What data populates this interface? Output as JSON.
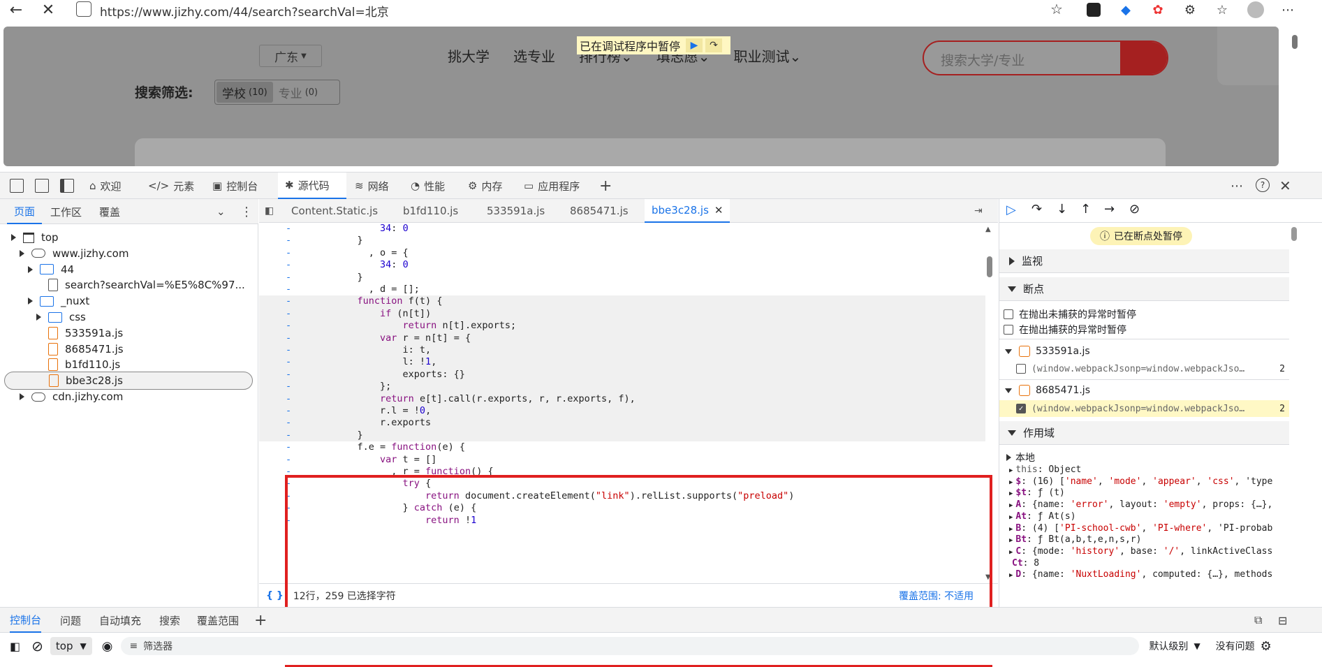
{
  "browser": {
    "url": "https://www.jizhy.com/44/search?searchVal=北京"
  },
  "page": {
    "province": "广东",
    "nav": [
      "挑大学",
      "选专业",
      "排行榜",
      "填志愿",
      "职业测试"
    ],
    "search_placeholder": "搜索大学/专业",
    "filter_label": "搜索筛选:",
    "filter_school": "学校",
    "filter_school_count": "(10)",
    "filter_major": "专业",
    "filter_major_count": "(0)",
    "paused_banner": "已在调试程序中暂停"
  },
  "devtools": {
    "tabs": [
      "欢迎",
      "元素",
      "控制台",
      "源代码",
      "网络",
      "性能",
      "内存",
      "应用程序"
    ],
    "active_tab": "源代码",
    "nav_tabs": [
      "页面",
      "工作区",
      "覆盖"
    ],
    "tree": [
      {
        "label": "top",
        "kind": "window",
        "indent": 0,
        "open": true
      },
      {
        "label": "www.jizhy.com",
        "kind": "cloud",
        "indent": 1,
        "open": true
      },
      {
        "label": "44",
        "kind": "folder",
        "indent": 2,
        "open": true
      },
      {
        "label": "search?searchVal=%E5%8C%97...",
        "kind": "file",
        "indent": 3
      },
      {
        "label": "_nuxt",
        "kind": "folder",
        "indent": 2,
        "open": true
      },
      {
        "label": "css",
        "kind": "folder",
        "indent": 3,
        "open": false
      },
      {
        "label": "533591a.js",
        "kind": "js",
        "indent": 3
      },
      {
        "label": "8685471.js",
        "kind": "js",
        "indent": 3
      },
      {
        "label": "b1fd110.js",
        "kind": "js",
        "indent": 3
      },
      {
        "label": "bbe3c28.js",
        "kind": "js",
        "indent": 3,
        "selected": true
      },
      {
        "label": "cdn.jizhy.com",
        "kind": "cloud",
        "indent": 1,
        "open": false
      }
    ],
    "editor_tabs": [
      "Content.Static.js",
      "b1fd110.js",
      "533591a.js",
      "8685471.js",
      "bbe3c28.js"
    ],
    "active_editor_tab": "bbe3c28.js",
    "code": [
      "        34: 0",
      "    }",
      "      , o = {",
      "        34: 0",
      "    }",
      "      , d = [];",
      "    function f(t) {",
      "        if (n[t])",
      "            return n[t].exports;",
      "        var r = n[t] = {",
      "            i: t,",
      "            l: !1,",
      "            exports: {}",
      "        };",
      "        return e[t].call(r.exports, r, r.exports, f),",
      "        r.l = !0,",
      "        r.exports",
      "    }",
      "    f.e = function(e) {",
      "        var t = []",
      "          , r = function() {",
      "            try {",
      "                return document.createElement(\"link\").relList.supports(\"preload\")",
      "            } catch (e) {",
      "                return !1"
    ],
    "status_text": "12行，259 已选择字符",
    "coverage_text": "覆盖范围: 不适用",
    "paused_badge": "已在断点处暂停",
    "sections": {
      "watch": "监视",
      "breakpoints": "断点",
      "scope": "作用域"
    },
    "exception_opts": [
      "在抛出未捕获的异常时暂停",
      "在抛出捕获的异常时暂停"
    ],
    "bp_files": [
      {
        "file": "533591a.js",
        "snippet": "(window.webpackJsonp=window.webpackJso…",
        "line": "2",
        "checked": false
      },
      {
        "file": "8685471.js",
        "snippet": "(window.webpackJsonp=window.webpackJso…",
        "line": "2",
        "checked": true
      }
    ],
    "scope_local": "本地",
    "scope_lines": [
      {
        "k": "this",
        "v": ": Object",
        "plain": true
      },
      {
        "k": "$",
        "v": ": (16) ['name', 'mode', 'appear', 'css', 'type"
      },
      {
        "k": "$t",
        "v": ": ƒ (t)"
      },
      {
        "k": "A",
        "v": ": {name: 'error', layout: 'empty', props: {…},"
      },
      {
        "k": "At",
        "v": ": ƒ At(s)"
      },
      {
        "k": "B",
        "v": ": (4) ['PI-school-cwb', 'PI-where', 'PI-probab"
      },
      {
        "k": "Bt",
        "v": ": ƒ Bt(a,b,t,e,n,s,r)"
      },
      {
        "k": "C",
        "v": ": {mode: 'history', base: '/', linkActiveClass"
      },
      {
        "k": "Ct",
        "v": ": 8",
        "noarrow": true
      },
      {
        "k": "D",
        "v": ": {name: 'NuxtLoading', computed: {…}, methods"
      }
    ],
    "drawer_tabs": [
      "控制台",
      "问题",
      "自动填充",
      "搜索",
      "覆盖范围"
    ],
    "console_context": "top",
    "filter_placeholder": "筛选器",
    "log_level": "默认级别",
    "issues": "没有问题"
  }
}
